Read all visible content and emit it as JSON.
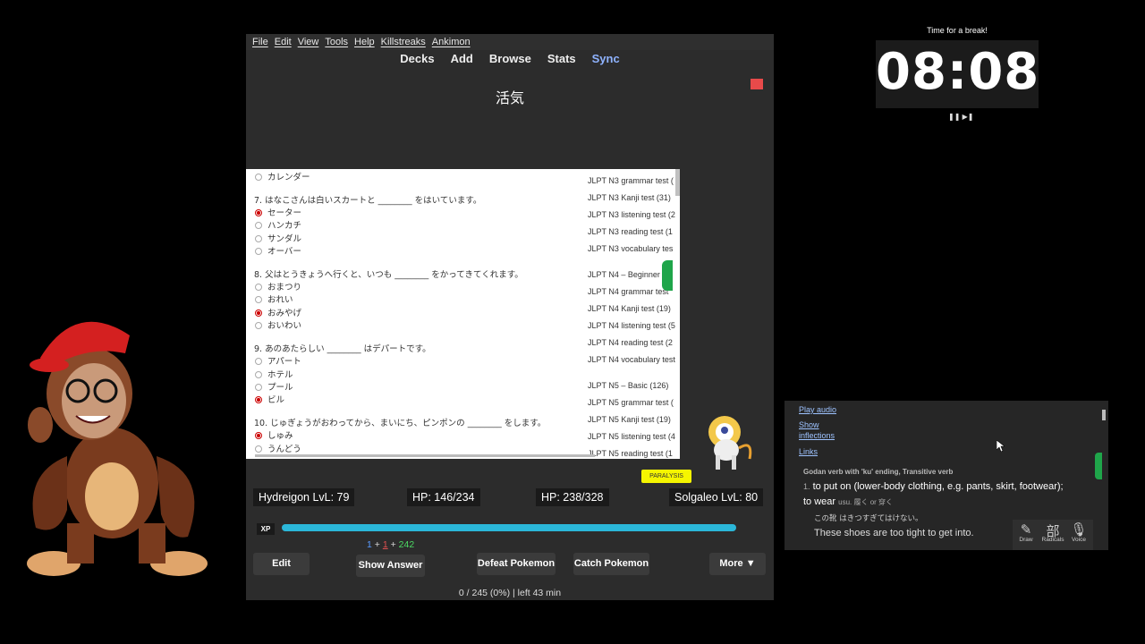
{
  "menu": [
    "File",
    "Edit",
    "View",
    "Tools",
    "Help",
    "Killstreaks",
    "Ankimon"
  ],
  "tabs": {
    "decks": "Decks",
    "add": "Add",
    "browse": "Browse",
    "stats": "Stats",
    "sync": "Sync"
  },
  "card": {
    "word": "活気"
  },
  "quiz": {
    "prev_option": "カレンダー",
    "questions": [
      {
        "text": "7. はなこさんは白いスカートと ________ をはいています。",
        "options": [
          "セーター",
          "ハンカチ",
          "サンダル",
          "オーバー"
        ],
        "selected": 0
      },
      {
        "text": "8. 父はとうきょうへ行くと、いつも ________ をかってきてくれます。",
        "options": [
          "おまつり",
          "おれい",
          "おみやげ",
          "おいわい"
        ],
        "selected": 2
      },
      {
        "text": "9. あのあたらしい ________ はデパートです。",
        "options": [
          "アパート",
          "ホテル",
          "プール",
          "ビル"
        ],
        "selected": 3
      },
      {
        "text": "10. じゅぎょうがおわってから、まいにち、ピンポンの ________ をします。",
        "options": [
          "しゅみ",
          "うんどう"
        ],
        "selected": 0
      }
    ],
    "tests": [
      "JLPT N3 grammar test (",
      "JLPT N3 Kanji test (31)",
      "JLPT N3 listening test (2",
      "JLPT N3 reading test (1",
      "JLPT N3 vocabulary tes",
      "JLPT N4 – Beginner",
      "JLPT N4 grammar test",
      "JLPT N4 Kanji test (19)",
      "JLPT N4 listening test (5",
      "JLPT N4 reading test (2",
      "JLPT N4 vocabulary test",
      "JLPT N5 – Basic (126)",
      "JLPT N5 grammar test (",
      "JLPT N5 Kanji test (19)",
      "JLPT N5 listening test (4",
      "JLPT N5 reading test (1"
    ]
  },
  "status_badge": "PARALYSIS",
  "battle": {
    "player": "Hydreigon LvL: 79",
    "player_hp": "HP: 146/234",
    "enemy_hp": "HP: 238/328",
    "enemy": "Solgaleo LvL: 80",
    "xp_label": "XP",
    "xp_fraction": 1.0
  },
  "counts": {
    "new": "1",
    "learn": "1",
    "review": "242",
    "plus": "+"
  },
  "buttons": {
    "edit": "Edit",
    "show_answer": "Show Answer",
    "defeat": "Defeat Pokemon",
    "catch": "Catch Pokemon",
    "more": "More ▼"
  },
  "progress": "0 / 245 (0%) | left 43 min",
  "timer": {
    "title": "Time for a break!",
    "value": "08:08",
    "controls": "❚❚ ▶❚"
  },
  "dictionary": {
    "play_audio": "Play audio",
    "show": "Show",
    "inflections": "inflections",
    "links": "Links",
    "pos": "Godan verb with 'ku' ending, Transitive verb",
    "def_num": "1.",
    "definition": "to put on (lower-body clothing, e.g. pants, skirt, footwear);",
    "definition2": "to wear",
    "note": "usu. 履く or 穿く",
    "example_jp": "この靴 はきつすぎてはけない。",
    "example_en": "These shoes are too tight to get into.",
    "tools": [
      {
        "glyph": "✎",
        "label": "Draw"
      },
      {
        "glyph": "部",
        "label": "Radicals"
      },
      {
        "glyph": "🎙",
        "label": "Voice"
      }
    ]
  },
  "colors": {
    "xp": "#2bb7d9",
    "sync": "#8fb3ff",
    "counts_new": "#5a9bff",
    "counts_learn": "#e05050",
    "counts_review": "#4cd964",
    "badge": "#f5f500"
  }
}
